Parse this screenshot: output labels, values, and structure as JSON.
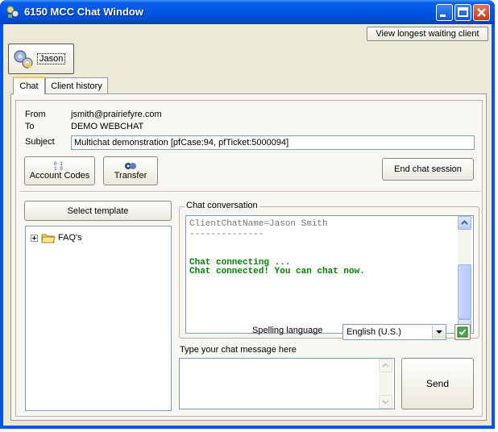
{
  "window": {
    "title": "6150 MCC Chat Window"
  },
  "header": {
    "view_longest_label": "View longest waiting client"
  },
  "client_tab": {
    "name": "Jason"
  },
  "tabs": [
    {
      "label": "Chat"
    },
    {
      "label": "Client history"
    }
  ],
  "info": {
    "from_label": "From",
    "from_value": "jsmith@prairiefyre.com",
    "to_label": "To",
    "to_value": "DEMO WEBCHAT",
    "subject_label": "Subject",
    "subject_value": "Multichat demonstration [pfCase:94, pfTicket:5000094]"
  },
  "actions": {
    "account_codes": "Account Codes",
    "transfer": "Transfer",
    "end_chat": "End chat session"
  },
  "template": {
    "select_label": "Select template",
    "tree_item": "FAQ's"
  },
  "chat": {
    "group_label": "Chat conversation",
    "line1": "ClientChatName=Jason Smith",
    "separator": "--------------",
    "status1": "Chat connecting ...",
    "status2": "Chat connected!  You can chat now."
  },
  "spelling": {
    "label": "Spelling language",
    "value": "English (U.S.)"
  },
  "message": {
    "label": "Type your chat message here",
    "send": "Send"
  },
  "colors": {
    "status_text": "#008000",
    "title_bar": "#0055e5",
    "client_bg": "#ece9d8"
  }
}
